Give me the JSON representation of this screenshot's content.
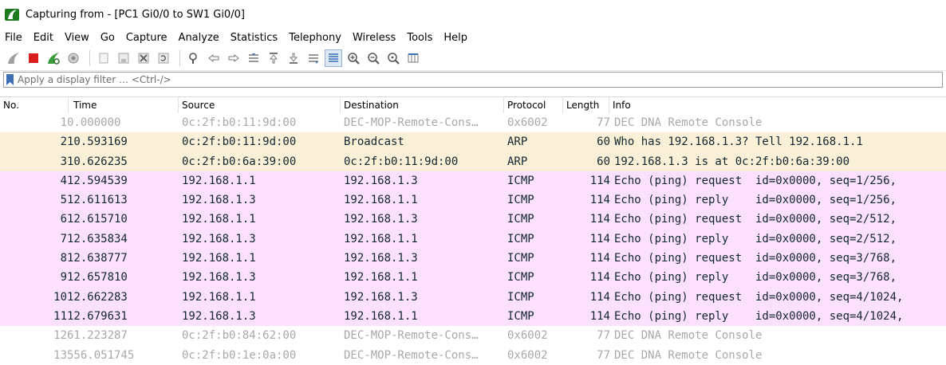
{
  "window": {
    "title": "Capturing from - [PC1 Gi0/0 to SW1 Gi0/0]"
  },
  "menu": [
    "File",
    "Edit",
    "View",
    "Go",
    "Capture",
    "Analyze",
    "Statistics",
    "Telephony",
    "Wireless",
    "Tools",
    "Help"
  ],
  "filter": {
    "placeholder": "Apply a display filter … <Ctrl-/>"
  },
  "columns": [
    "No.",
    "Time",
    "Source",
    "Destination",
    "Protocol",
    "Length",
    "Info"
  ],
  "packets": [
    {
      "no": "1",
      "time": "0.000000",
      "source": "0c:2f:b0:11:9d:00",
      "destination": "DEC-MOP-Remote-Cons…",
      "protocol": "0x6002",
      "length": "77",
      "info": "DEC DNA Remote Console",
      "kind": "dec"
    },
    {
      "no": "2",
      "time": "10.593169",
      "source": "0c:2f:b0:11:9d:00",
      "destination": "Broadcast",
      "protocol": "ARP",
      "length": "60",
      "info": "Who has 192.168.1.3? Tell 192.168.1.1",
      "kind": "arp"
    },
    {
      "no": "3",
      "time": "10.626235",
      "source": "0c:2f:b0:6a:39:00",
      "destination": "0c:2f:b0:11:9d:00",
      "protocol": "ARP",
      "length": "60",
      "info": "192.168.1.3 is at 0c:2f:b0:6a:39:00",
      "kind": "arp"
    },
    {
      "no": "4",
      "time": "12.594539",
      "source": "192.168.1.1",
      "destination": "192.168.1.3",
      "protocol": "ICMP",
      "length": "114",
      "info": "Echo (ping) request  id=0x0000, seq=1/256,",
      "kind": "icmp"
    },
    {
      "no": "5",
      "time": "12.611613",
      "source": "192.168.1.3",
      "destination": "192.168.1.1",
      "protocol": "ICMP",
      "length": "114",
      "info": "Echo (ping) reply    id=0x0000, seq=1/256,",
      "kind": "icmp"
    },
    {
      "no": "6",
      "time": "12.615710",
      "source": "192.168.1.1",
      "destination": "192.168.1.3",
      "protocol": "ICMP",
      "length": "114",
      "info": "Echo (ping) request  id=0x0000, seq=2/512,",
      "kind": "icmp"
    },
    {
      "no": "7",
      "time": "12.635834",
      "source": "192.168.1.3",
      "destination": "192.168.1.1",
      "protocol": "ICMP",
      "length": "114",
      "info": "Echo (ping) reply    id=0x0000, seq=2/512,",
      "kind": "icmp"
    },
    {
      "no": "8",
      "time": "12.638777",
      "source": "192.168.1.1",
      "destination": "192.168.1.3",
      "protocol": "ICMP",
      "length": "114",
      "info": "Echo (ping) request  id=0x0000, seq=3/768,",
      "kind": "icmp"
    },
    {
      "no": "9",
      "time": "12.657810",
      "source": "192.168.1.3",
      "destination": "192.168.1.1",
      "protocol": "ICMP",
      "length": "114",
      "info": "Echo (ping) reply    id=0x0000, seq=3/768,",
      "kind": "icmp"
    },
    {
      "no": "10",
      "time": "12.662283",
      "source": "192.168.1.1",
      "destination": "192.168.1.3",
      "protocol": "ICMP",
      "length": "114",
      "info": "Echo (ping) request  id=0x0000, seq=4/1024,",
      "kind": "icmp"
    },
    {
      "no": "11",
      "time": "12.679631",
      "source": "192.168.1.3",
      "destination": "192.168.1.1",
      "protocol": "ICMP",
      "length": "114",
      "info": "Echo (ping) reply    id=0x0000, seq=4/1024,",
      "kind": "icmp"
    },
    {
      "no": "12",
      "time": "61.223287",
      "source": "0c:2f:b0:84:62:00",
      "destination": "DEC-MOP-Remote-Cons…",
      "protocol": "0x6002",
      "length": "77",
      "info": "DEC DNA Remote Console",
      "kind": "dec"
    },
    {
      "no": "13",
      "time": "556.051745",
      "source": "0c:2f:b0:1e:0a:00",
      "destination": "DEC-MOP-Remote-Cons…",
      "protocol": "0x6002",
      "length": "77",
      "info": "DEC DNA Remote Console",
      "kind": "dec"
    }
  ],
  "colors": {
    "arp_row": "#faf0d7",
    "icmp_row": "#fce0ff",
    "dec_text": "#a8a8a8"
  }
}
